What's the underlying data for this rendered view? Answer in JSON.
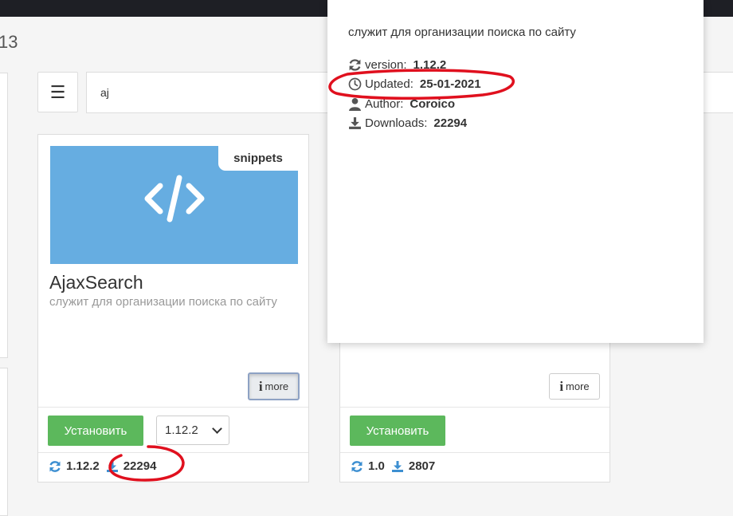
{
  "page": {
    "partial_number": "13"
  },
  "toolbar": {
    "menu_glyph": "☰",
    "search_value": "aj",
    "search_placeholder": ""
  },
  "cards": [
    {
      "thumbnail_tag": "snippets",
      "title": "AjaxSearch",
      "description": "служит для организации поиска по сайту",
      "more_label": "more",
      "install_label": "Установить",
      "version_select": "1.12.2",
      "version": "1.12.2",
      "downloads": "22294"
    },
    {
      "more_label": "more",
      "install_label": "Установить",
      "version": "1.0",
      "downloads": "2807"
    }
  ],
  "popup": {
    "description": "служит для организации поиска по сайту",
    "version_label": "version:",
    "version_value": "1.12.2",
    "updated_label": "Updated:",
    "updated_value": "25-01-2021",
    "author_label": "Author:",
    "author_value": "Coroico",
    "downloads_label": "Downloads:",
    "downloads_value": "22294"
  },
  "colors": {
    "install": "#5cb85c",
    "thumbnail": "#66ade1",
    "stat_icon": "#3d8fd1",
    "annotation": "#e0101e",
    "topbar": "#1e1f25"
  },
  "icons": [
    "menu-icon",
    "code-icon",
    "info-icon",
    "chevron-down-icon",
    "refresh-icon",
    "download-icon",
    "clock-icon",
    "user-icon"
  ]
}
